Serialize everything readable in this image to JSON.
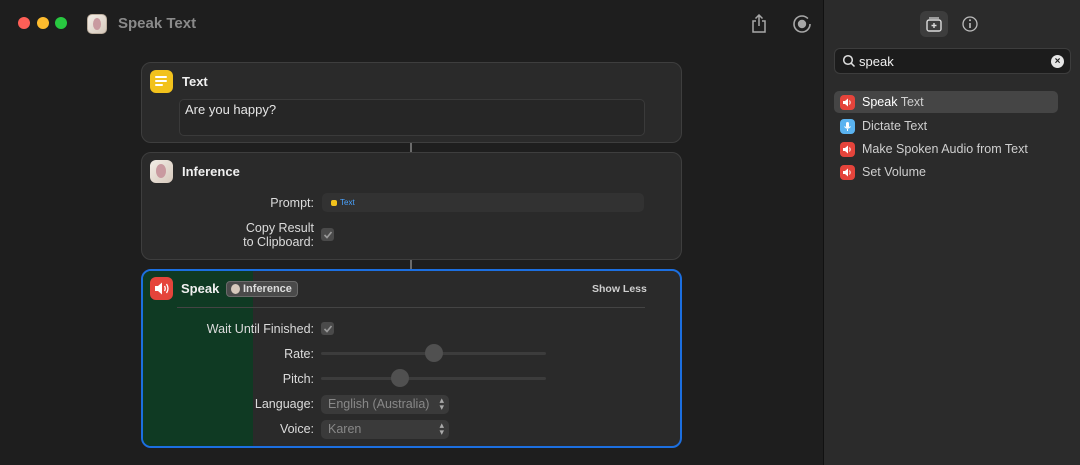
{
  "window": {
    "title": "Speak Text"
  },
  "colors": {
    "accent": "#1c6fe0",
    "text_action": "#f2c21c",
    "speak_action": "#e5443b",
    "dictate_action": "#5ab3f0"
  },
  "icons": {
    "app": "brain-app-icon",
    "share": "share-icon",
    "run": "run-icon",
    "library": "add-action-icon",
    "info": "info-icon",
    "search": "search-icon",
    "clear": "clear-icon",
    "speaker": "speaker-icon",
    "mic": "mic-icon"
  },
  "actions": {
    "text": {
      "title": "Text",
      "content": "Are you happy?"
    },
    "inference": {
      "title": "Inference",
      "prompt_label": "Prompt:",
      "prompt_token": "Text",
      "copy_label_line1": "Copy Result",
      "copy_label_line2": "to Clipboard:",
      "copy_checked": true
    },
    "speak": {
      "title": "Speak",
      "input_token": "Inference",
      "show_less": "Show Less",
      "wait_label": "Wait Until Finished:",
      "wait_checked": true,
      "rate_label": "Rate:",
      "rate_value": 0.5,
      "pitch_label": "Pitch:",
      "pitch_value": 0.35,
      "language_label": "Language:",
      "language_value": "English (Australia)",
      "voice_label": "Voice:",
      "voice_value": "Karen"
    }
  },
  "sidebar": {
    "search": {
      "value": "speak"
    },
    "results": [
      {
        "match": "Speak",
        "rest": " Text",
        "icon": "speaker-icon",
        "selected": true
      },
      {
        "match": "",
        "rest": "Dictate Text",
        "icon": "mic-icon",
        "selected": false
      },
      {
        "match": "",
        "rest": "Make Spoken Audio from Text",
        "icon": "speaker-icon",
        "selected": false
      },
      {
        "match": "",
        "rest": "Set Volume",
        "icon": "speaker-icon",
        "selected": false
      }
    ]
  }
}
